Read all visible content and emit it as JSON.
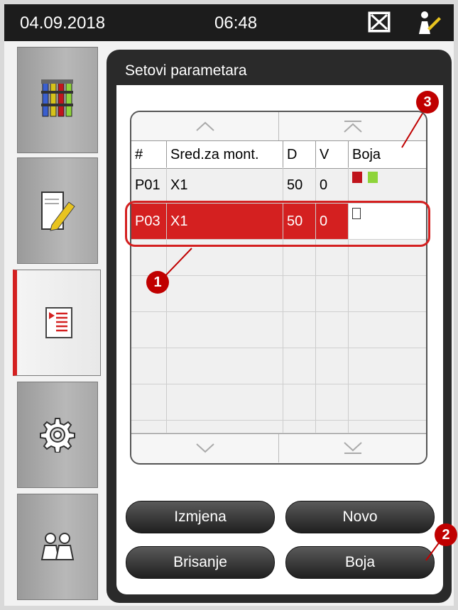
{
  "status_bar": {
    "date": "04.09.2018",
    "time": "06:48"
  },
  "sidebar": {
    "items": [
      {
        "name": "reagents",
        "icon": "reagent-bottles-icon"
      },
      {
        "name": "slide-labels",
        "icon": "coverslip-edit-icon"
      },
      {
        "name": "parameter-sets",
        "icon": "program-list-icon",
        "active": true
      },
      {
        "name": "settings",
        "icon": "gear-icon"
      },
      {
        "name": "users",
        "icon": "user-group-icon"
      }
    ]
  },
  "panel": {
    "title": "Setovi parametara"
  },
  "table": {
    "columns": [
      "#",
      "Sred.za mont.",
      "D",
      "V",
      "Boja"
    ],
    "rows": [
      {
        "id": "P01",
        "medium": "X1",
        "d": "50",
        "v": "0",
        "colors": [
          "#c0141c",
          "#8ed43a"
        ]
      },
      {
        "id": "P03",
        "medium": "X1",
        "d": "50",
        "v": "0",
        "colors": [
          "#ffffff"
        ],
        "selected": true
      }
    ]
  },
  "buttons": {
    "edit": "Izmjena",
    "new": "Novo",
    "delete": "Brisanje",
    "color": "Boja"
  },
  "callouts": [
    "1",
    "2",
    "3"
  ],
  "colors": {
    "accent": "#d42020",
    "callout": "#c00000"
  }
}
